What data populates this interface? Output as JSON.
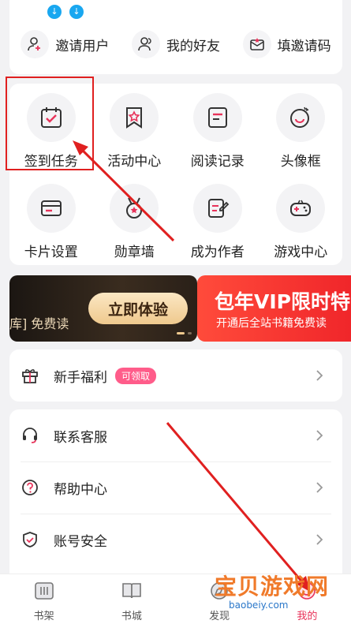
{
  "top_actions": [
    {
      "label": "邀请用户",
      "icon": "invite-user-icon"
    },
    {
      "label": "我的好友",
      "icon": "friends-icon"
    },
    {
      "label": "填邀请码",
      "icon": "invite-code-icon"
    }
  ],
  "grid": [
    {
      "label": "签到任务",
      "icon": "checkin-calendar-icon"
    },
    {
      "label": "活动中心",
      "icon": "activity-star-icon"
    },
    {
      "label": "阅读记录",
      "icon": "reading-record-icon"
    },
    {
      "label": "头像框",
      "icon": "avatar-frame-icon"
    },
    {
      "label": "卡片设置",
      "icon": "card-settings-icon"
    },
    {
      "label": "勋章墙",
      "icon": "medal-icon"
    },
    {
      "label": "成为作者",
      "icon": "author-edit-icon"
    },
    {
      "label": "游戏中心",
      "icon": "gamepad-icon"
    }
  ],
  "banner_left": {
    "text": "库] 免费读",
    "button": "立即体验"
  },
  "banner_right": {
    "title": "包年VIP限时特",
    "subtitle": "开通后全站书籍免费读"
  },
  "newbie": {
    "label": "新手福利",
    "badge": "可领取"
  },
  "list": [
    {
      "label": "联系客服",
      "icon": "customer-service-icon"
    },
    {
      "label": "帮助中心",
      "icon": "help-icon"
    },
    {
      "label": "账号安全",
      "icon": "shield-icon"
    }
  ],
  "nav": [
    {
      "label": "书架",
      "icon": "bookshelf-icon"
    },
    {
      "label": "书城",
      "icon": "bookstore-icon"
    },
    {
      "label": "发现",
      "icon": "discover-icon"
    },
    {
      "label": "我的",
      "icon": "profile-icon"
    }
  ],
  "watermark": {
    "title": "宝贝游戏网",
    "url": "baobeiy.com"
  },
  "colors": {
    "accent": "#e8335a",
    "annotation": "#e02020",
    "download": "#19a7f0"
  }
}
